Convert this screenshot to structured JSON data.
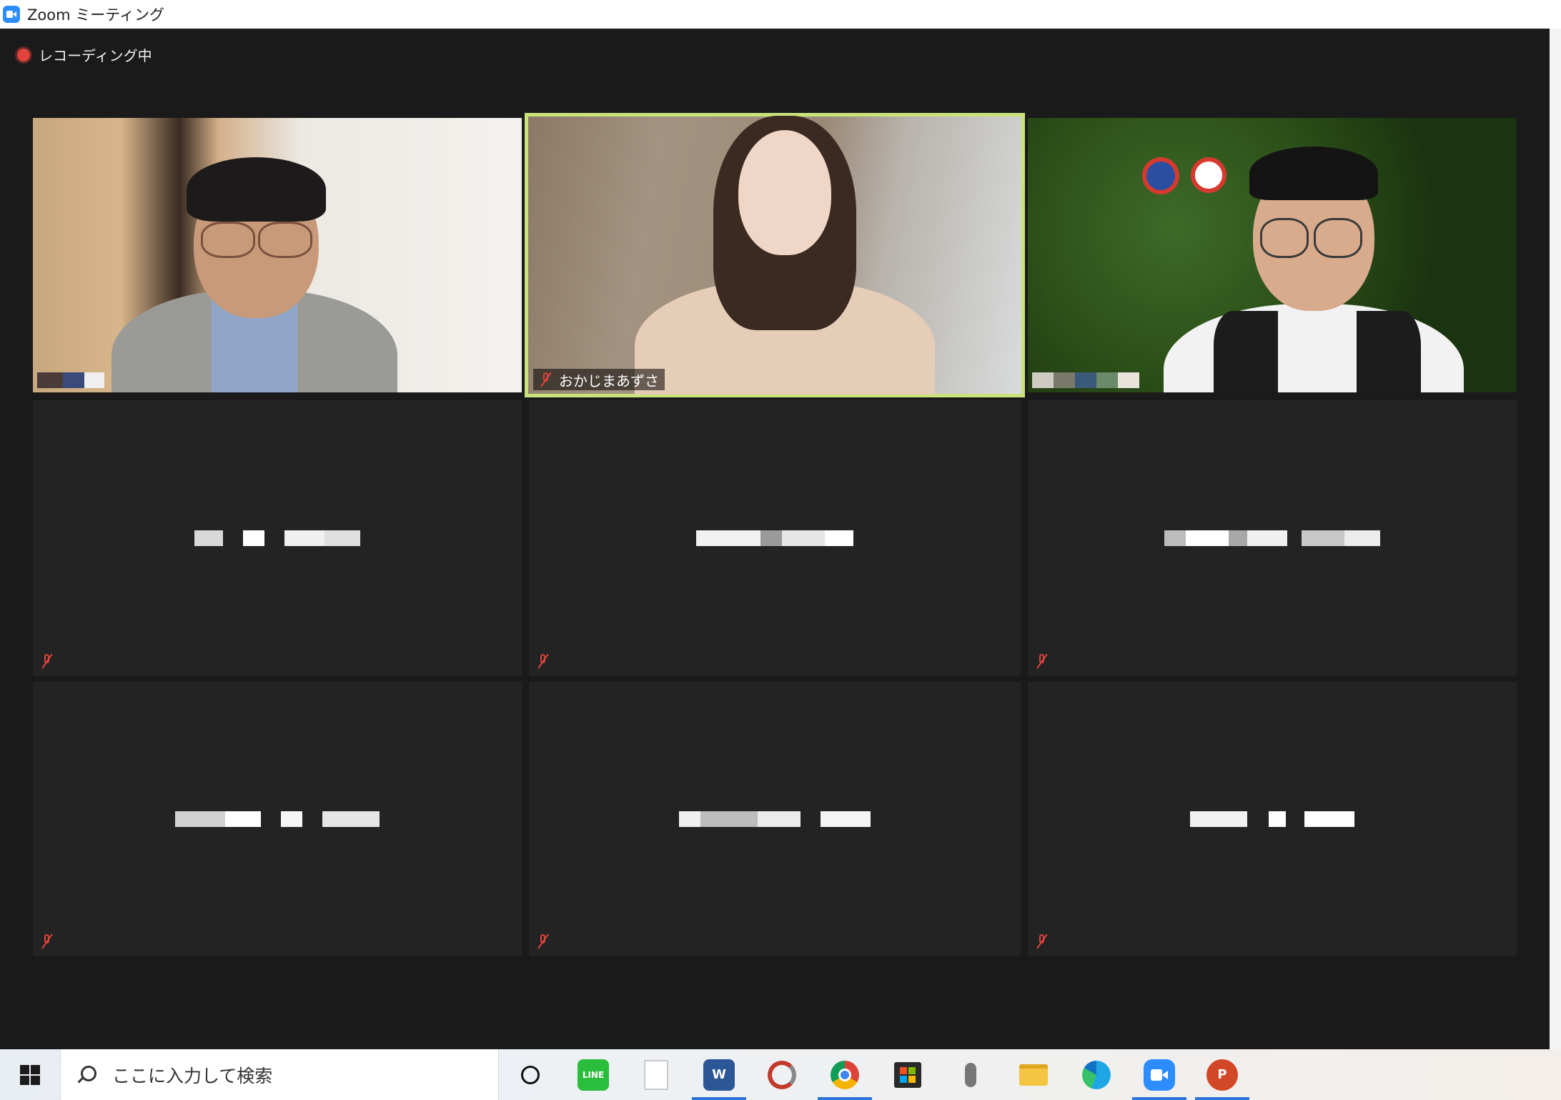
{
  "window": {
    "title": "Zoom ミーティング"
  },
  "recording": {
    "label": "レコーディング中"
  },
  "participants": [
    {
      "name": "",
      "muted": false,
      "video": true
    },
    {
      "name": "おかじまあずさ",
      "muted": true,
      "video": true,
      "active_speaker": true
    },
    {
      "name": "",
      "muted": false,
      "video": true
    },
    {
      "name": "",
      "muted": true,
      "video": false
    },
    {
      "name": "",
      "muted": true,
      "video": false
    },
    {
      "name": "",
      "muted": true,
      "video": false
    },
    {
      "name": "",
      "muted": true,
      "video": false
    },
    {
      "name": "",
      "muted": true,
      "video": false
    },
    {
      "name": "",
      "muted": true,
      "video": false
    }
  ],
  "taskbar": {
    "search_placeholder": "ここに入力して検索",
    "apps": [
      {
        "icon": "task-view-icon"
      },
      {
        "icon": "line-icon",
        "label": "LINE"
      },
      {
        "icon": "file-icon"
      },
      {
        "icon": "word-icon",
        "label": "W"
      },
      {
        "icon": "pdf-tool-icon"
      },
      {
        "icon": "chrome-icon"
      },
      {
        "icon": "store-icon"
      },
      {
        "icon": "voice-recorder-icon"
      },
      {
        "icon": "file-explorer-icon"
      },
      {
        "icon": "edge-icon"
      },
      {
        "icon": "zoom-icon"
      },
      {
        "icon": "powerpoint-icon",
        "label": "P"
      }
    ]
  },
  "colors": {
    "active_speaker_border": "#c9e37a",
    "mute_red": "#e0433b",
    "meeting_bg": "#1a1a1a",
    "tile_bg": "#232323"
  }
}
